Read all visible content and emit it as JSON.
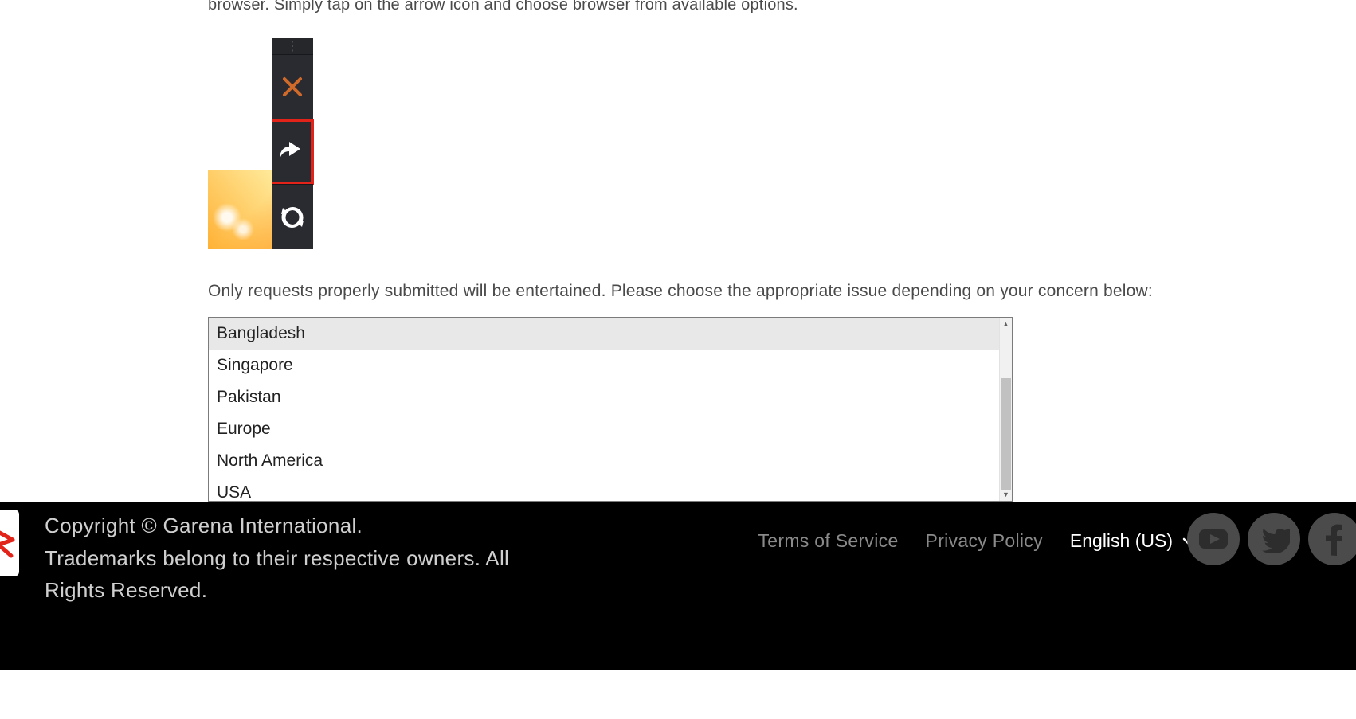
{
  "article": {
    "partial_line": "browser. Simply tap on the arrow icon and choose browser from available options.",
    "instruction": "Only requests properly submitted will be entertained. Please choose the appropriate issue depending on your concern below:"
  },
  "region_select": {
    "options": [
      "Bangladesh",
      "Singapore",
      "Pakistan",
      "Europe",
      "North America",
      "USA"
    ],
    "selected_index": 0
  },
  "footer": {
    "copyright_line1": "Copyright © Garena International.",
    "copyright_line2": "Trademarks belong to their respective owners. All Rights Reserved.",
    "links": {
      "tos": "Terms of Service",
      "privacy": "Privacy Policy"
    },
    "language": "English (US)"
  },
  "icons": {
    "close": "close-icon",
    "share_arrow": "share-arrow-icon",
    "refresh": "refresh-icon",
    "chevron_down": "chevron-down-icon",
    "youtube": "youtube-icon",
    "twitter": "twitter-icon",
    "facebook": "facebook-icon",
    "garena_logo": "garena-logo-icon"
  }
}
